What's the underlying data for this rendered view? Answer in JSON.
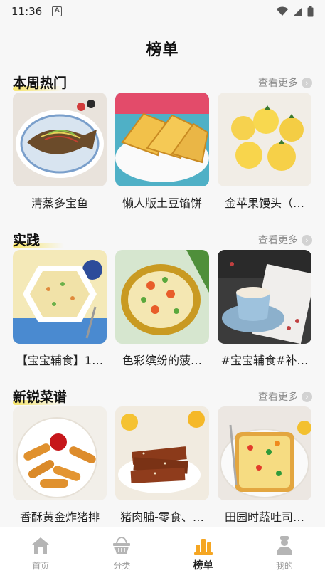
{
  "status_bar": {
    "time": "11:36",
    "badge": "A"
  },
  "page": {
    "title": "榜单"
  },
  "sections": [
    {
      "title": "本周热门",
      "more_label": "查看更多",
      "items": [
        {
          "name": "清蒸多宝鱼"
        },
        {
          "name": "懒人版土豆馅饼"
        },
        {
          "name": "金苹果馒头（…"
        }
      ]
    },
    {
      "title": "实践",
      "more_label": "查看更多",
      "items": [
        {
          "name": "【宝宝辅食】1…"
        },
        {
          "name": "色彩缤纷的菠…"
        },
        {
          "name": "#宝宝辅食#补…"
        }
      ]
    },
    {
      "title": "新锐菜谱",
      "more_label": "查看更多",
      "items": [
        {
          "name": "香酥黄金炸猪排"
        },
        {
          "name": "猪肉脯-零食、…"
        },
        {
          "name": "田园时蔬吐司…"
        }
      ]
    }
  ],
  "tabbar": {
    "tabs": [
      {
        "label": "首页",
        "icon": "home-icon"
      },
      {
        "label": "分类",
        "icon": "basket-icon"
      },
      {
        "label": "榜单",
        "icon": "ranking-icon",
        "active": true
      },
      {
        "label": "我的",
        "icon": "profile-icon"
      }
    ]
  },
  "colors": {
    "accent": "#f5a623",
    "underline": "#f6e46a",
    "inactive": "#b5b5b5"
  }
}
